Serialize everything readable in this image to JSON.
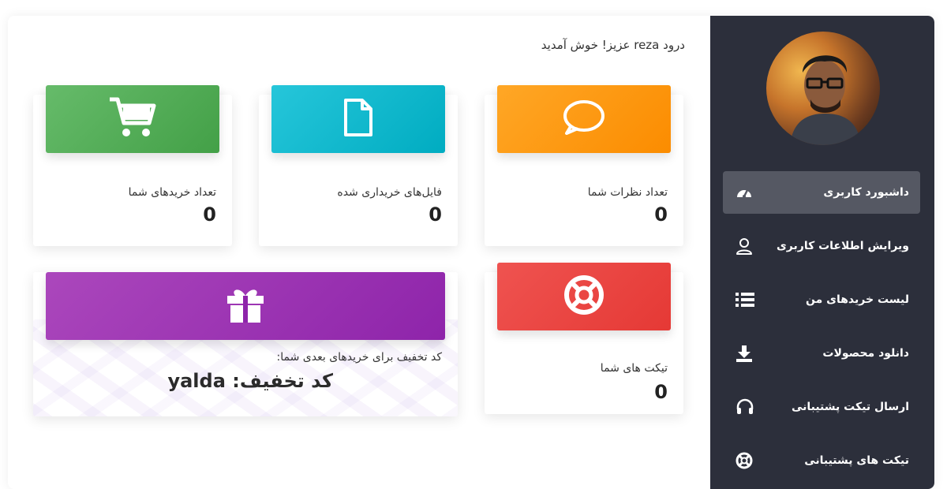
{
  "header": {
    "welcome": "درود reza عزیز! خوش آمدید"
  },
  "sidebar": {
    "avatar": "user-avatar",
    "items": [
      {
        "label": "داشبورد کاربری",
        "icon": "dashboard-gauge-icon",
        "active": true
      },
      {
        "label": "ویرایش اطلاعات کاربری",
        "icon": "user-icon",
        "active": false
      },
      {
        "label": "لیست خریدهای من",
        "icon": "list-icon",
        "active": false
      },
      {
        "label": "دانلود محصولات",
        "icon": "download-icon",
        "active": false
      },
      {
        "label": "ارسال تیکت پشتیبانی",
        "icon": "headset-icon",
        "active": false
      },
      {
        "label": "تیکت های پشتیبانی",
        "icon": "lifebuoy-icon",
        "active": false
      }
    ]
  },
  "stats": {
    "comments": {
      "label": "تعداد نظرات شما",
      "value": "0",
      "icon": "comment-icon",
      "color": "#fb8c00"
    },
    "files": {
      "label": "فایل‌های خریداری شده",
      "value": "0",
      "icon": "file-icon",
      "color": "#00acc1"
    },
    "purchases": {
      "label": "تعداد خریدهای شما",
      "value": "0",
      "icon": "cart-icon",
      "color": "#43a047"
    },
    "tickets": {
      "label": "تیکت های شما",
      "value": "0",
      "icon": "lifebuoy-icon",
      "color": "#e53935"
    }
  },
  "discount": {
    "label": "کد تخفیف برای خریدهای بعدی شما:",
    "code_text": "کد تخفیف: yalda",
    "icon": "gift-icon",
    "color": "#8e24aa"
  }
}
